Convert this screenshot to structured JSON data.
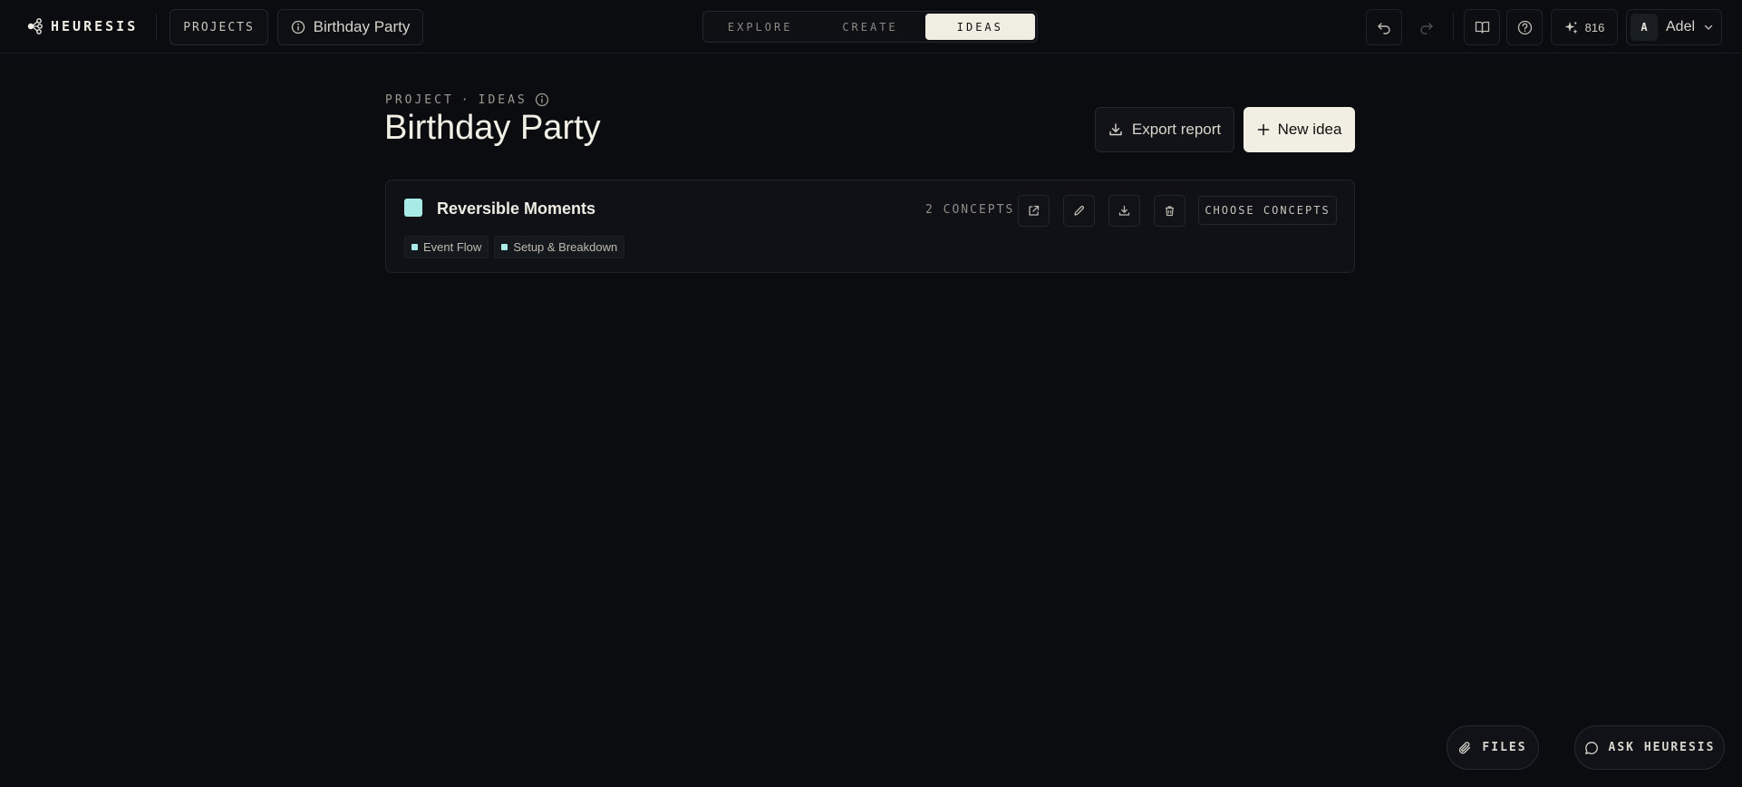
{
  "app": {
    "brand": "HEURESIS"
  },
  "topbar": {
    "projects_label": "PROJECTS",
    "current_project": "Birthday Party",
    "modes": [
      {
        "label": "EXPLORE",
        "active": false
      },
      {
        "label": "CREATE",
        "active": false
      },
      {
        "label": "IDEAS",
        "active": true
      }
    ],
    "credits": "816",
    "user": {
      "initial": "A",
      "name": "Adel"
    }
  },
  "page": {
    "eyebrow_left": "PROJECT",
    "eyebrow_sep": "·",
    "eyebrow_right": "IDEAS",
    "title": "Birthday Party",
    "export_label": "Export report",
    "new_label": "New idea"
  },
  "ideas": [
    {
      "title": "Reversible Moments",
      "color": "#a8ebe6",
      "concept_count": "2 CONCEPTS",
      "choose_label": "CHOOSE CONCEPTS",
      "tags": [
        {
          "label": "Event Flow",
          "color": "#a8ebe6"
        },
        {
          "label": "Setup & Breakdown",
          "color": "#a8ebe6"
        }
      ]
    }
  ],
  "floating": {
    "files_label": "FILES",
    "ask_label": "ASK HEURESIS"
  },
  "colors": {
    "background": "#0a0c10",
    "accent": "#f1eee3",
    "idea_swatch": "#a8ebe6"
  }
}
